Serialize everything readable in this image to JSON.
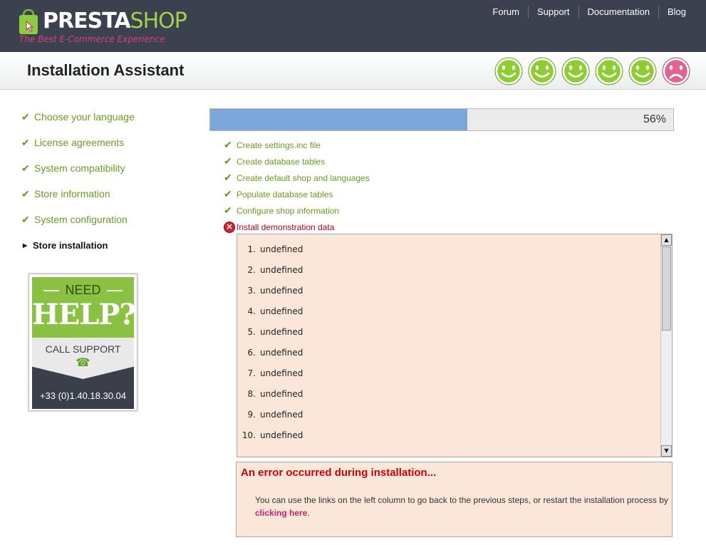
{
  "header": {
    "logo_presta": "PRESTA",
    "logo_shop": "SHOP",
    "tagline": "The Best E-Commerce Experience",
    "nav": [
      "Forum",
      "Support",
      "Documentation",
      "Blog"
    ]
  },
  "title": "Installation Assistant",
  "moods": [
    "happy",
    "happy",
    "happy",
    "happy",
    "happy",
    "sad"
  ],
  "steps": [
    {
      "label": "Choose your language",
      "state": "done"
    },
    {
      "label": "License agreements",
      "state": "done"
    },
    {
      "label": "System compatibility",
      "state": "done"
    },
    {
      "label": "Store information",
      "state": "done"
    },
    {
      "label": "System configuration",
      "state": "done"
    },
    {
      "label": "Store installation",
      "state": "current"
    }
  ],
  "help": {
    "need": "NEED",
    "big": "HELP?",
    "call": "CALL SUPPORT",
    "phone": "+33 (0)1.40.18.30.04"
  },
  "progress": {
    "percent": 56,
    "label": "56%"
  },
  "tasks": [
    {
      "label": "Create settings.inc file",
      "state": "done"
    },
    {
      "label": "Create database tables",
      "state": "done"
    },
    {
      "label": "Create default shop and languages",
      "state": "done"
    },
    {
      "label": "Populate database tables",
      "state": "done"
    },
    {
      "label": "Configure shop information",
      "state": "done"
    },
    {
      "label": "Install demonstration data",
      "state": "error"
    }
  ],
  "log": [
    {
      "num": "1.",
      "text": "undefined"
    },
    {
      "num": "2.",
      "text": "undefined"
    },
    {
      "num": "3.",
      "text": "undefined"
    },
    {
      "num": "4.",
      "text": "undefined"
    },
    {
      "num": "5.",
      "text": "undefined"
    },
    {
      "num": "6.",
      "text": "undefined"
    },
    {
      "num": "7.",
      "text": "undefined"
    },
    {
      "num": "8.",
      "text": "undefined"
    },
    {
      "num": "9.",
      "text": "undefined"
    },
    {
      "num": "10.",
      "text": "undefined"
    }
  ],
  "error": {
    "title": "An error occurred during installation...",
    "message": "You can use the links on the left column to go back to the previous steps, or restart the installation process by",
    "link": "clicking here",
    "end": "."
  },
  "colors": {
    "green": "#6b9b22",
    "error": "#cc0000",
    "progress": "#7aa6da",
    "panel": "#fbe7d9"
  }
}
